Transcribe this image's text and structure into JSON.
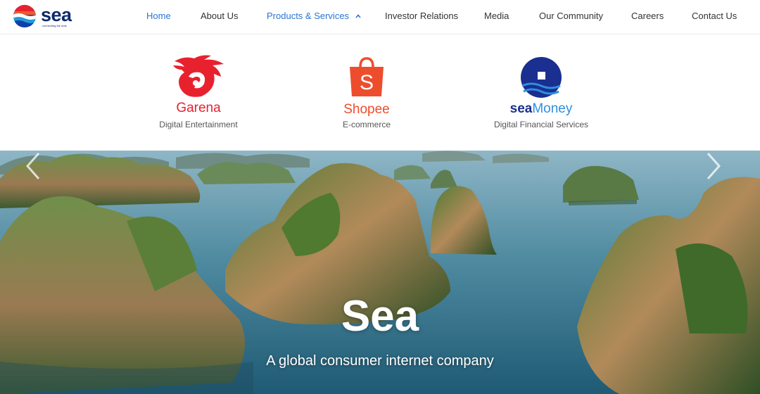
{
  "brand": {
    "logo_text": "sea",
    "tagline": "connecting the dots",
    "logo_icon": "sea-globe-logo"
  },
  "nav": {
    "items": [
      {
        "label": "Home",
        "active": true
      },
      {
        "label": "About Us"
      },
      {
        "label": "Products & Services",
        "has_dropdown": true,
        "open": true
      },
      {
        "label": "Investor Relations"
      },
      {
        "label": "Media"
      },
      {
        "label": "Our Community"
      },
      {
        "label": "Careers"
      },
      {
        "label": "Contact Us"
      }
    ]
  },
  "products": [
    {
      "name": "Garena",
      "caption": "Digital Entertainment",
      "icon": "garena-dragon-logo",
      "color": "#e8212e"
    },
    {
      "name": "Shopee",
      "caption": "E-commerce",
      "icon": "shopee-bag-logo",
      "color": "#ee4d2d"
    },
    {
      "name_part1": "sea",
      "name_part2": "Money",
      "caption": "Digital Financial Services",
      "icon": "seamoney-coin-logo",
      "color": "#1a2f8f"
    }
  ],
  "hero": {
    "title": "Sea",
    "subtitle": "A global consumer internet company",
    "prev_icon": "chevron-left-icon",
    "next_icon": "chevron-right-icon"
  },
  "colors": {
    "accent": "#2a76d2",
    "nav_text": "#333333",
    "garena_red": "#e8212e",
    "shopee_orange": "#ee4d2d",
    "seamoney_blue": "#1a2f8f"
  }
}
